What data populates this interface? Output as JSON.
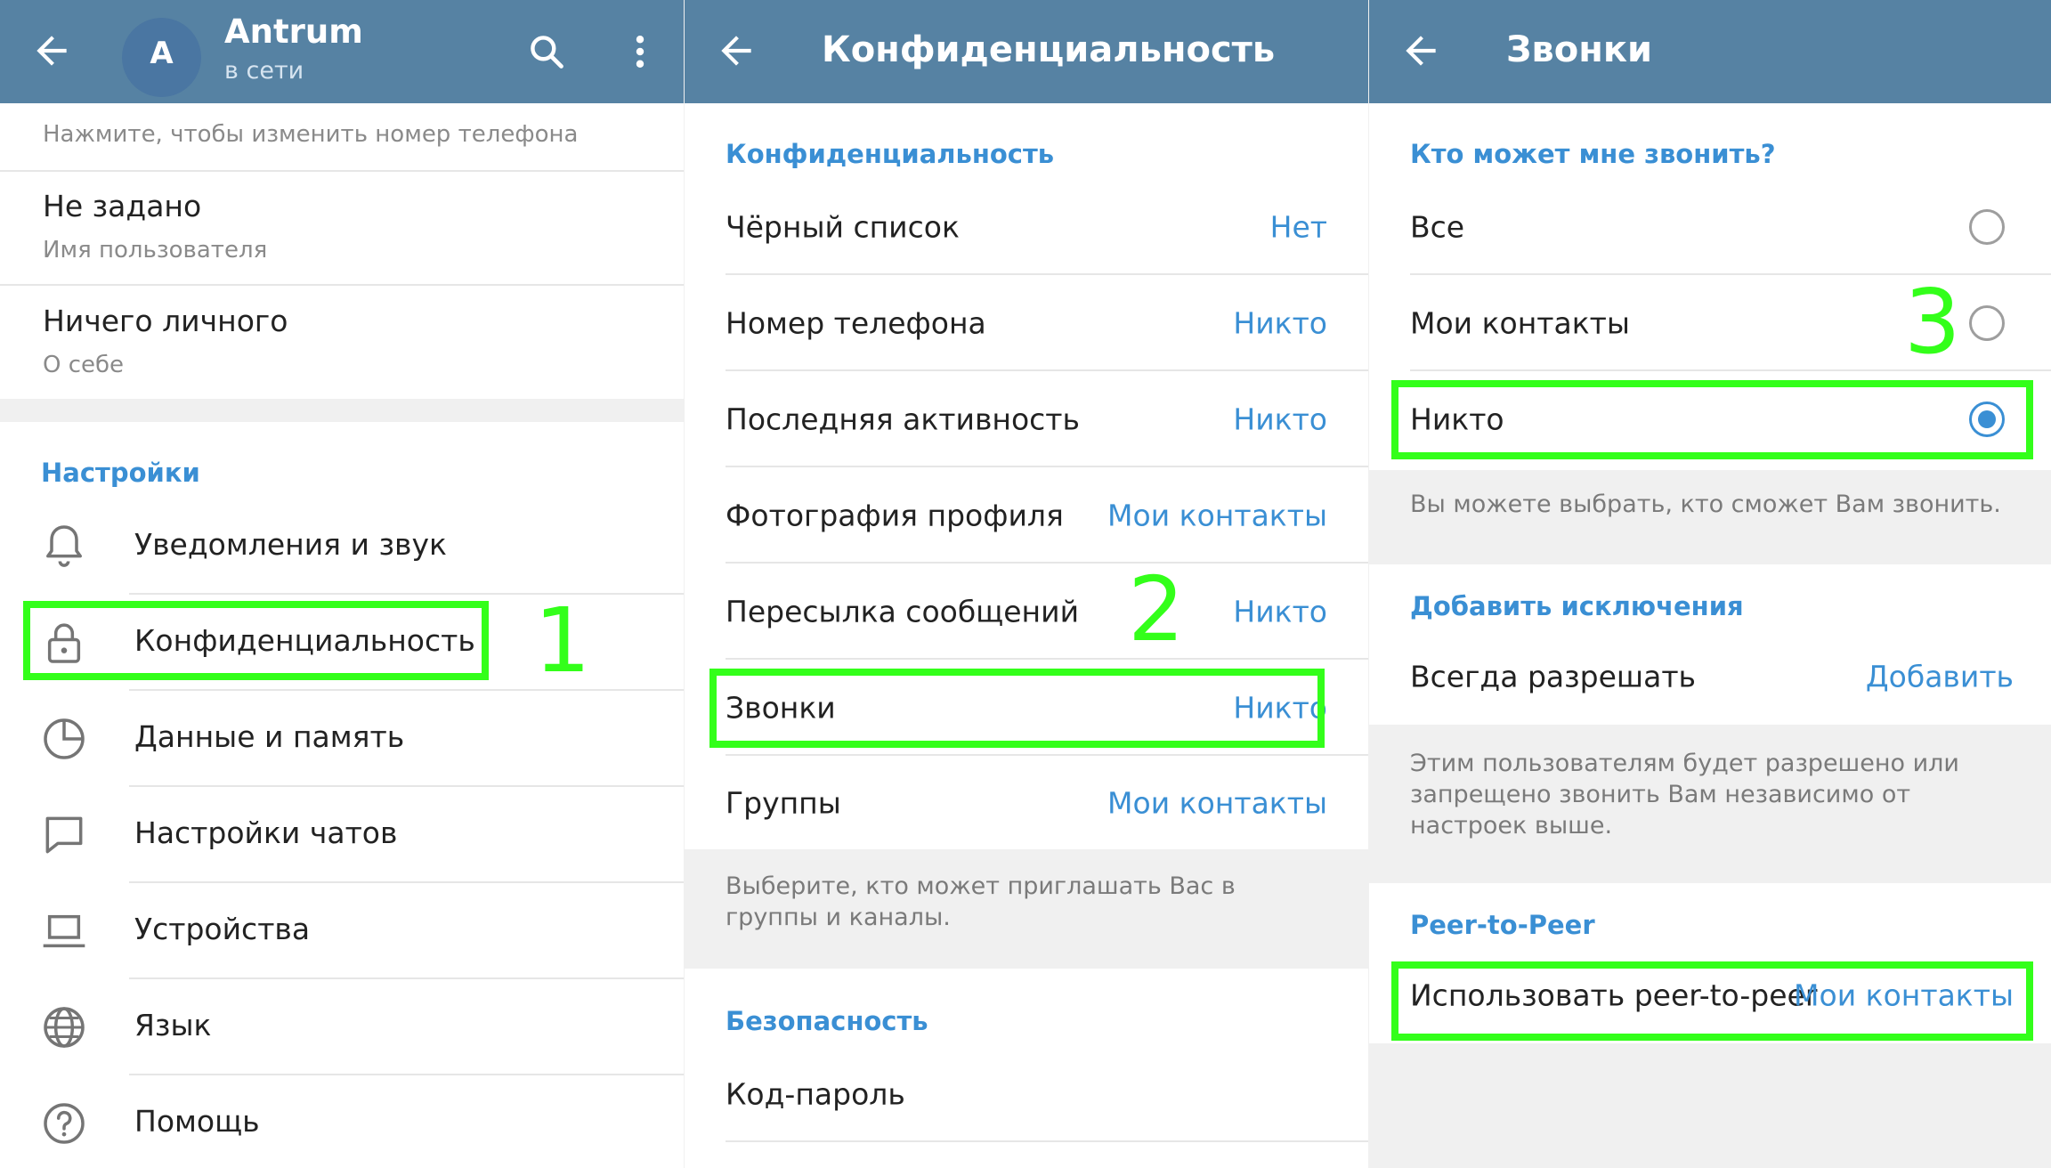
{
  "colors": {
    "header": "#5682a3",
    "accent": "#3a8fd4",
    "highlight": "#33ff1a"
  },
  "panel1": {
    "header": {
      "name": "Antrum",
      "status": "в сети",
      "avatar_letter": "A",
      "icons": [
        "back-arrow-icon",
        "search-icon",
        "more-vertical-icon"
      ]
    },
    "profile": {
      "phone_hint": "Нажмите, чтобы изменить номер телефона",
      "username_value": "Не задано",
      "username_label": "Имя пользователя",
      "bio_value": "Ничего личного",
      "bio_label": "О себе"
    },
    "settings_title": "Настройки",
    "settings": [
      {
        "label": "Уведомления и звук",
        "icon": "bell-icon"
      },
      {
        "label": "Конфиденциальность",
        "icon": "lock-icon"
      },
      {
        "label": "Данные и память",
        "icon": "pie-chart-icon"
      },
      {
        "label": "Настройки чатов",
        "icon": "chat-bubble-icon"
      },
      {
        "label": "Устройства",
        "icon": "laptop-icon"
      },
      {
        "label": "Язык",
        "icon": "globe-icon"
      },
      {
        "label": "Помощь",
        "icon": "help-icon"
      }
    ],
    "step": "1"
  },
  "panel2": {
    "title": "Конфиденциальность",
    "section_privacy": "Конфиденциальность",
    "rows": [
      {
        "label": "Чёрный список",
        "value": "Нет"
      },
      {
        "label": "Номер телефона",
        "value": "Никто"
      },
      {
        "label": "Последняя активность",
        "value": "Никто"
      },
      {
        "label": "Фотография профиля",
        "value": "Мои контакты"
      },
      {
        "label": "Пересылка сообщений",
        "value": "Никто"
      },
      {
        "label": "Звонки",
        "value": "Никто"
      },
      {
        "label": "Группы",
        "value": "Мои контакты"
      }
    ],
    "groups_note": "Выберите, кто может приглашать Вас в группы и каналы.",
    "section_security": "Безопасность",
    "passcode": "Код-пароль",
    "step": "2"
  },
  "panel3": {
    "title": "Звонки",
    "who_title": "Кто может мне звонить?",
    "options": [
      {
        "label": "Все",
        "selected": false
      },
      {
        "label": "Мои контакты",
        "selected": false
      },
      {
        "label": "Никто",
        "selected": true
      }
    ],
    "who_note": "Вы можете выбрать, кто сможет Вам звонить.",
    "exceptions_title": "Добавить исключения",
    "always_allow": "Всегда разрешать",
    "always_allow_action": "Добавить",
    "exceptions_note": "Этим пользователям будет разрешено или запрещено звонить Вам независимо от настроек выше.",
    "p2p_title": "Peer-to-Peer",
    "p2p_label": "Использовать peer-to-peer",
    "p2p_value": "Мои контакты",
    "step": "3"
  }
}
